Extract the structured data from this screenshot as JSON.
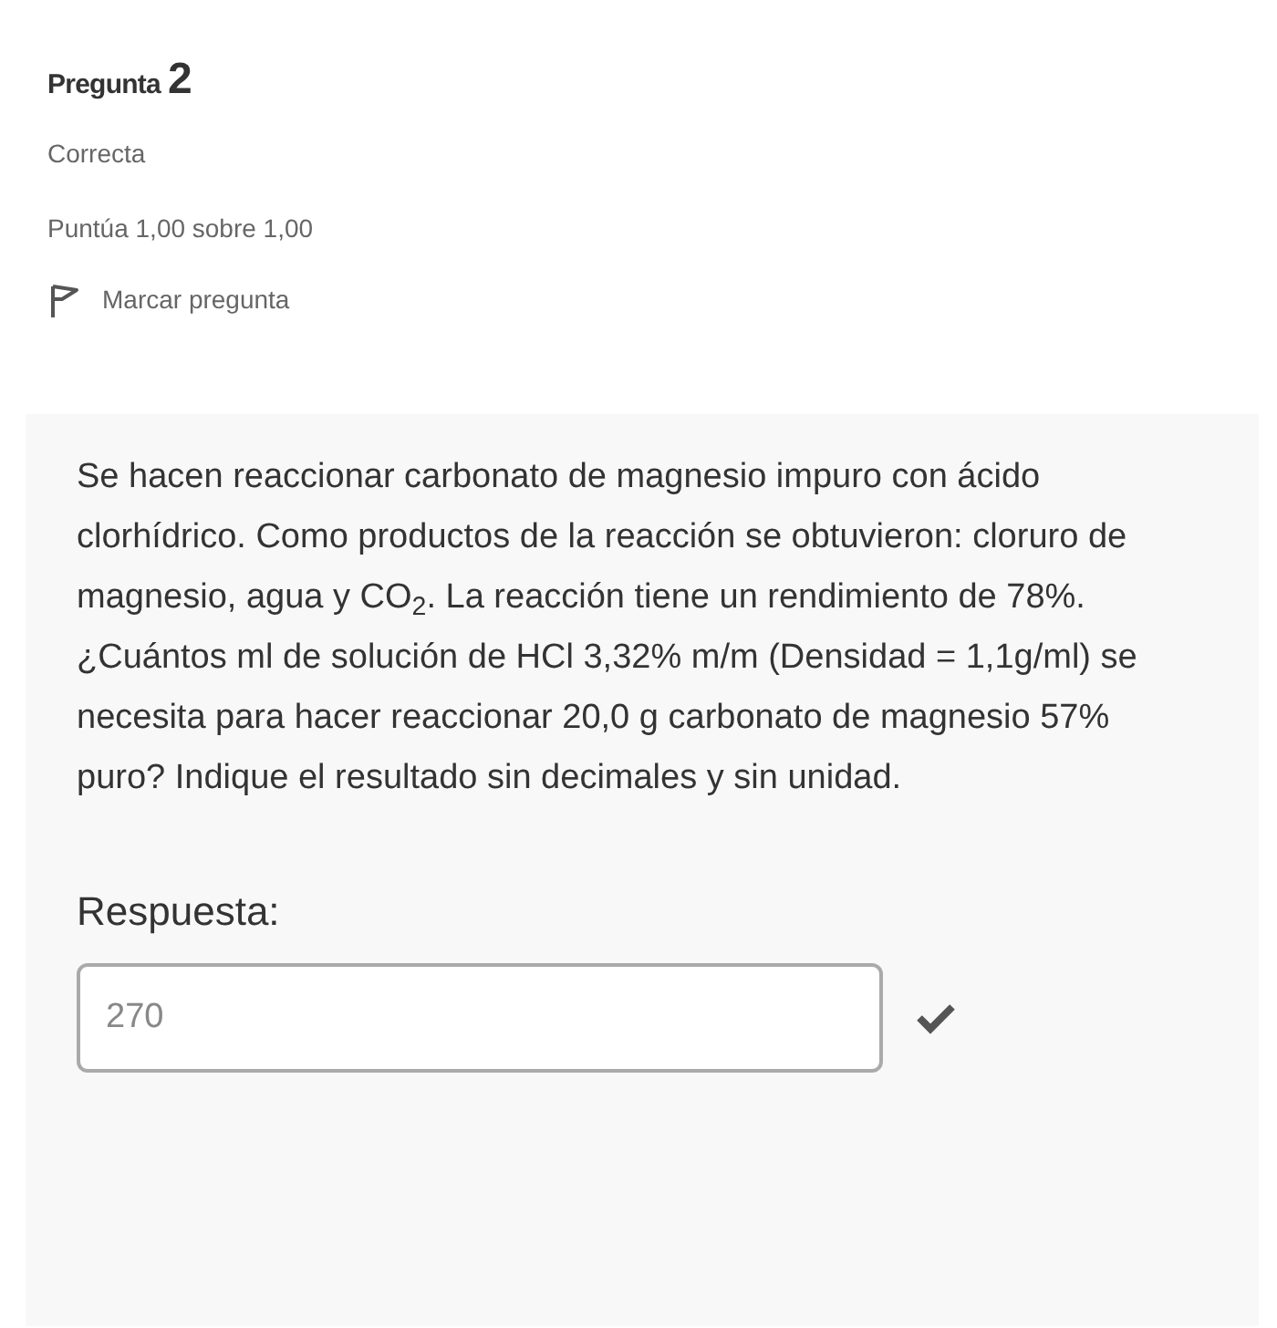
{
  "question": {
    "label": "Pregunta",
    "number": "2",
    "status": "Correcta",
    "grade": "Puntúa 1,00 sobre 1,00",
    "flag": {
      "label": "Marcar pregunta",
      "flagged": false
    }
  },
  "content": {
    "text": "Se hacen reaccionar carbonato de magnesio impuro con ácido clorhídrico. Como productos de la reacción se obtuvieron: cloruro de magnesio, agua y CO$_{2}$. La reacción tiene un rendimiento de 78%. ¿Cuántos ml de solución de HCl 3,32% m/m (Densidad = 1,1g/ml) se necesita para hacer reaccionar 20,0 g carbonato de magnesio 57% puro? Indique el resultado sin decimales y sin unidad.",
    "answer_label": "Respuesta:",
    "answer": {
      "value": "270",
      "correct": true
    }
  }
}
